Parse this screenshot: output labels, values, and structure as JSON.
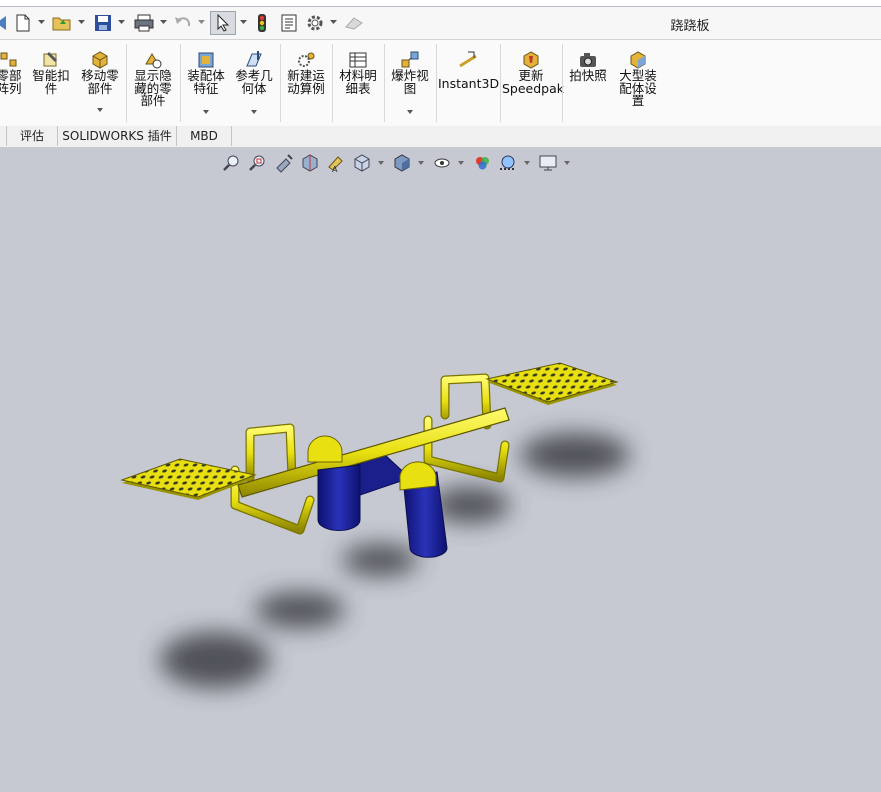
{
  "window": {
    "title": "跷跷板"
  },
  "ribbon": {
    "items": [
      {
        "id": "linear-pattern",
        "label": "零部\n阵列"
      },
      {
        "id": "smart-fasteners",
        "label": "智能扣\n件"
      },
      {
        "id": "move-component",
        "label": "移动零\n部件"
      },
      {
        "id": "show-hidden",
        "label": "显示隐\n藏的零\n部件"
      },
      {
        "id": "assembly-features",
        "label": "装配体\n特征"
      },
      {
        "id": "reference-geometry",
        "label": "参考几\n何体"
      },
      {
        "id": "new-motion-study",
        "label": "新建运\n动算例"
      },
      {
        "id": "bill-of-materials",
        "label": "材料明\n细表"
      },
      {
        "id": "exploded-view",
        "label": "爆炸视\n图"
      },
      {
        "id": "instant3d",
        "label": "Instant3D"
      },
      {
        "id": "update-speedpak",
        "label": "更新\nSpeedpak"
      },
      {
        "id": "take-snapshot",
        "label": "拍快照"
      },
      {
        "id": "large-assembly-settings",
        "label": "大型装\n配体设\n置"
      }
    ]
  },
  "tabs": [
    {
      "label": ""
    },
    {
      "label": "评估"
    },
    {
      "label": "SOLIDWORKS 插件"
    },
    {
      "label": "MBD"
    }
  ],
  "colors": {
    "viewport_bg": "#c6c9d2",
    "seesaw_yellow": "#e8e010",
    "seesaw_blue": "#1a1f8c",
    "shadow": "#3a3c42"
  }
}
